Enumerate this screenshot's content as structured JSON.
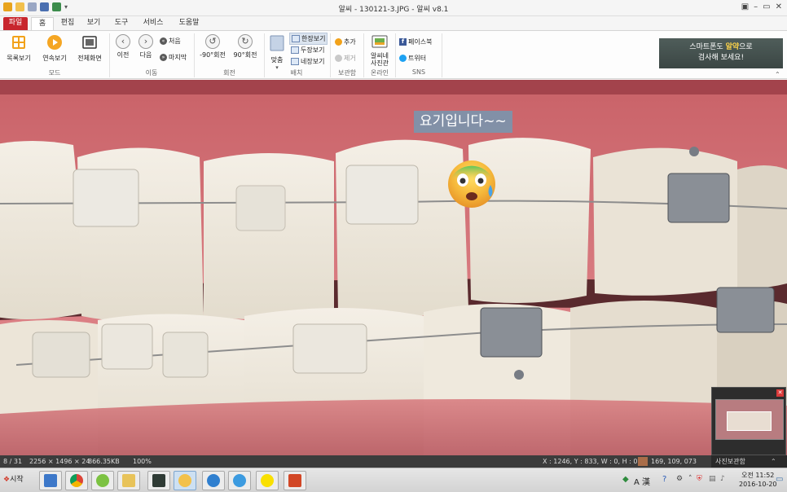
{
  "window": {
    "title": "알씨 - 130121-3.JPG - 알씨 v8.1",
    "controls": [
      "▣",
      "–",
      "▭",
      "✕"
    ]
  },
  "menu": {
    "tabs": [
      "파일",
      "홈",
      "편집",
      "보기",
      "도구",
      "서비스",
      "도움말"
    ],
    "active": "홈"
  },
  "ribbon": {
    "mode": {
      "label": "모드",
      "buttons": [
        "목록보기",
        "연속보기",
        "전체화면"
      ]
    },
    "move": {
      "label": "이동",
      "prev": "이전",
      "next": "다음",
      "first": "처음",
      "last": "마지막"
    },
    "rotate": {
      "label": "회전",
      "left": "-90°회전",
      "right": "90°회전"
    },
    "layout": {
      "label": "배치",
      "fit": "맞춤",
      "single": "한장보기",
      "double": "두장보기",
      "quad": "네장보기"
    },
    "storage": {
      "label": "보관함",
      "add": "추가",
      "remove": "제거"
    },
    "online": {
      "label": "온라인",
      "button_line1": "알씨네",
      "button_line2": "사진관"
    },
    "sns": {
      "label": "SNS",
      "facebook": "페이스북",
      "twitter": "트위터"
    },
    "promo": {
      "line1_pre": "스마트폰도 ",
      "brand": "알약",
      "line1_post": "으로",
      "line2": "검사해 보세요!"
    }
  },
  "viewer": {
    "caption": "요기입니다~~",
    "emoji": "anxious-face-with-sweat",
    "thumbnail_panel_label": "사진보관함"
  },
  "status": {
    "position": "8 / 31",
    "dimensions": "2256 × 1496 × 24",
    "filesize": "866.35KB",
    "zoom": "100%",
    "coords": "X : 1246, Y : 833, W : 0, H : 0",
    "color_rgb": "169, 109, 073",
    "color_hex": "#a96d49"
  },
  "taskbar": {
    "start": "시작",
    "tray_lang": "A 漢",
    "clock_time": "오전 11:52",
    "clock_date": "2016-10-20"
  },
  "colors": {
    "file_tab": "#c8262d",
    "status_bg": "#3c3c3c",
    "caption_bg": "#7896af"
  }
}
